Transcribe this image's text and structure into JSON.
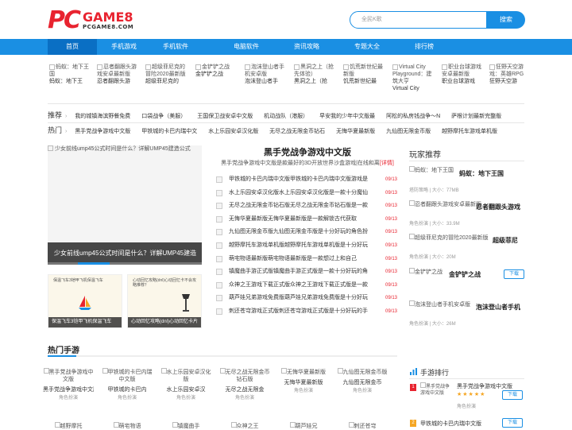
{
  "header": {
    "logo_pc": "PC",
    "logo_game": "GAME8",
    "logo_url": "PCGAME8.COM",
    "search_placeholder": "全民K歌",
    "search_button": "搜索"
  },
  "nav": [
    "首页",
    "手机游戏",
    "手机软件",
    "电脑软件",
    "资讯攻略",
    "专题大全",
    "排行榜"
  ],
  "thumbs": [
    {
      "img": "蚂蚁：地下王国",
      "label": "蚂蚁：地下王"
    },
    {
      "img": "忍者翻跟头游戏安卓最新版",
      "label": "忍者翻跟头游"
    },
    {
      "img": "超级菲尼克的冒险2020最新版",
      "label": "超级菲尼克的"
    },
    {
      "img": "金铲铲之战",
      "label": "金铲铲之战"
    },
    {
      "img": "泡沫登山者手机安卓版",
      "label": "泡沫登山者手"
    },
    {
      "img": "黑洞之上（抢先体验）",
      "label": "黑洞之上（抢"
    },
    {
      "img": "饥荒新世纪最新版",
      "label": "饥荒新世纪最"
    },
    {
      "img": "Virtual City Playground：建筑大亨",
      "label": "Virtual City"
    },
    {
      "img": "职业台球游戏安卓最新版",
      "label": "职业台球游戏"
    },
    {
      "img": "狂野天空游戏：英雄RPG",
      "label": "狂野天空游"
    }
  ],
  "recommend": {
    "head": "推荐",
    "links": [
      "我的城镇海滨野餐免费",
      "口袋战争（美服）",
      "王国保卫战安卓中文版",
      "机动战队（港服）",
      "早安我的少年中文版最",
      "阿松的私房钱战争～N",
      "萨根计划最新完整版"
    ]
  },
  "hot": {
    "head": "热门",
    "links": [
      "黑手党战争游戏中文版",
      "甲铁城的卡巴内瑞中文",
      "水上乐园安卓汉化版",
      "无尽之战无限金币钻石",
      "无悔华夏最新版",
      "九仙图无限金币版",
      "越野摩托车游戏单机版"
    ]
  },
  "slider": {
    "img_alt": "少女前线ump45公式时间是什么？详解UMP45建造公式",
    "caption": "少女前线ump45公式时间是什么？详解UMP45建造"
  },
  "cards": [
    {
      "inner": "保温飞车3铠甲飞机保温飞车",
      "caption": "保温飞车3铠甲飞机保温飞车"
    },
    {
      "inner": "心动回忆攻略(dnl)心动回忆卡不会攻略推荐？",
      "caption": "心动回忆攻略(dnl)心动回忆卡片"
    }
  ],
  "news": {
    "headline": "黑手党战争游戏中文版",
    "summary": "黑手党战争游戏中文版是款最好的3D开放世界沙盒游戏|在线和离",
    "more": "[详情]",
    "items": [
      {
        "text": "甲铁城的卡巴内瑞中文版甲铁城的卡巴内瑞中文版游戏是",
        "date": "09/13"
      },
      {
        "text": "水上乐园安卓汉化版水上乐园安卓汉化版是一款十分魔仙",
        "date": "09/13"
      },
      {
        "text": "无尽之战无限金币钻石版无尽之战无限金币钻石版是一款",
        "date": "09/13"
      },
      {
        "text": "无悔华夏最新版无悔华夏最新版是一款解锁古代获取",
        "date": "09/13"
      },
      {
        "text": "九仙图无限金币版九仙图无限金币版是十分好玩的角色扮",
        "date": "09/13"
      },
      {
        "text": "越野摩托车游戏单机版越野摩托车游戏单机版是十分好玩",
        "date": "09/13"
      },
      {
        "text": "萌宅物语最新版萌宅物语最新版是一款想过上和自己",
        "date": "09/13"
      },
      {
        "text": "镇魔曲手游正式版镇魔曲手游正式版是一款十分好玩的角",
        "date": "09/13"
      },
      {
        "text": "众神之王游戏下载正式版众神之王游戏下载正式版是一款",
        "date": "09/13"
      },
      {
        "text": "葫芦娃兄弟游戏免费版葫芦娃兄弟游戏免费版是十分好玩",
        "date": "09/13"
      },
      {
        "text": "刺还苍穹游戏正式版刺还苍穹游戏正式版是十分好玩的手",
        "date": "09/13"
      }
    ]
  },
  "players": {
    "head": "玩家推荐",
    "items": [
      {
        "img": "蚂蚁：地下王国",
        "name": "蚂蚁：地下王国",
        "meta": "塔防策略 | 大小：77MB"
      },
      {
        "img": "忍者翻跟头游戏安卓最新版",
        "name": "忍者翻跟头游戏",
        "meta": "角色扮演 | 大小：33.9M"
      },
      {
        "img": "超级菲尼克的冒险2020最新版",
        "name": "超级菲尼",
        "meta": "角色扮演 | 大小：20M"
      },
      {
        "img": "金铲铲之战",
        "name": "金铲铲之战",
        "meta": "",
        "button": "下载"
      },
      {
        "img": "泡沫登山者手机安卓版",
        "name": "泡沫登山者手机",
        "meta": "角色扮演 | 大小：26M"
      }
    ]
  },
  "hot_games": {
    "head": "热门手游",
    "items": [
      {
        "img": "黑手党战争游戏中文版",
        "name": "黑手党战争游戏中文版",
        "cat": "角色扮演"
      },
      {
        "img": "甲铁城的卡巴内瑞中文版",
        "name": "甲铁城的卡巴内",
        "cat": "角色扮演"
      },
      {
        "img": "水上乐园安卓汉化版",
        "name": "水上乐园安卓汉",
        "cat": "角色扮演"
      },
      {
        "img": "无尽之战无限金币钻石版",
        "name": "无尽之战无限金",
        "cat": "角色扮演"
      },
      {
        "img": "无悔华夏最新版",
        "name": "无悔华夏最新版",
        "cat": "角色扮演"
      },
      {
        "img": "九仙图无限金币版",
        "name": "九仙图无限金币",
        "cat": "角色扮演"
      },
      {
        "img": "越野摩托",
        "name": "",
        "cat": ""
      },
      {
        "img": "萌宅物语",
        "name": "",
        "cat": ""
      },
      {
        "img": "镇魔曲手",
        "name": "",
        "cat": ""
      },
      {
        "img": "众神之王",
        "name": "",
        "cat": ""
      },
      {
        "img": "葫芦娃兄",
        "name": "",
        "cat": ""
      },
      {
        "img": "刺还苍穹",
        "name": "",
        "cat": ""
      }
    ]
  },
  "ranking": {
    "head": "手游排行",
    "first": {
      "num": "1",
      "img": "黑手党战争游戏中文版",
      "name": "黑手党战争游戏中文版",
      "stars": "★★★★★",
      "cat": "角色扮演",
      "button": "下载"
    },
    "second": {
      "num": "2",
      "name": "甲铁城的卡巴内瑞中文版",
      "button": "下载"
    }
  },
  "colors": {
    "brand": "#e8232f",
    "accent": "#1a8fe3"
  }
}
